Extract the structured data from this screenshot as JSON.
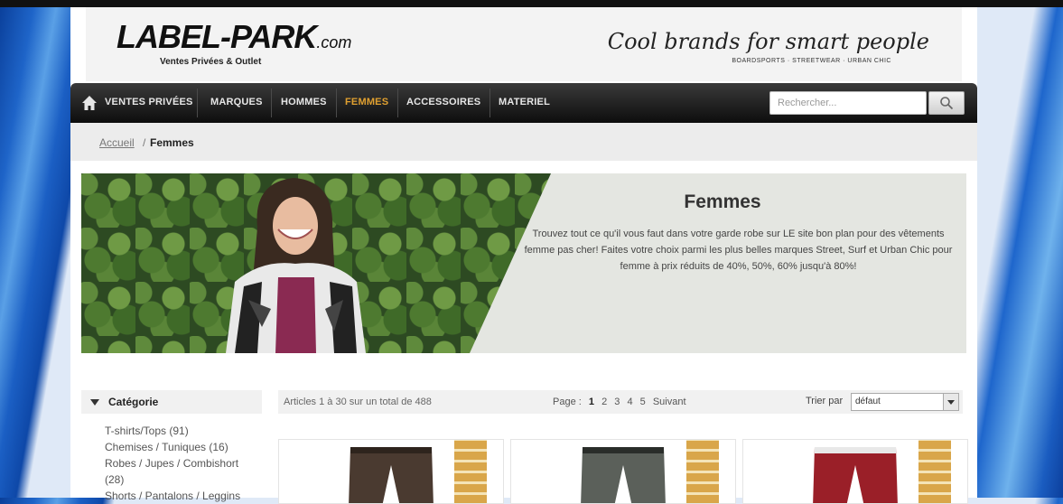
{
  "header": {
    "logo_main": "LABEL-PARK",
    "logo_suffix": ".com",
    "logo_tagline": "Ventes Privées & Outlet",
    "slogan": "Cool brands for smart people",
    "slogan_sub": "BOARDSPORTS · STREETWEAR · URBAN CHIC"
  },
  "nav": {
    "items": [
      "VENTES PRIVÉES",
      "MARQUES",
      "HOMMES",
      "FEMMES",
      "ACCESSOIRES",
      "MATERIEL"
    ],
    "active": "FEMMES",
    "search_placeholder": "Rechercher..."
  },
  "breadcrumb": {
    "home": "Accueil",
    "separator": "/",
    "current": "Femmes"
  },
  "banner": {
    "title": "Femmes",
    "text": "Trouvez tout ce qu'il vous faut dans votre garde robe sur LE site bon plan pour des vêtements femme pas cher! Faites votre choix parmi les plus belles marques Street, Surf et Urban Chic pour femme à prix réduits de 40%, 50%, 60% jusqu'à 80%!"
  },
  "sidebar": {
    "title": "Catégorie",
    "categories": [
      "T-shirts/Tops (91)",
      "Chemises / Tuniques (16)",
      "Robes / Jupes / Combishort",
      "(28)",
      "Shorts / Pantalons / Leggins"
    ]
  },
  "toolbar": {
    "count_text": "Articles 1 à 30 sur un total de 488",
    "page_label": "Page :",
    "pages": [
      "1",
      "2",
      "3",
      "4",
      "5"
    ],
    "current_page": "1",
    "next_label": "Suivant",
    "sort_label": "Trier par",
    "sort_value": "défaut"
  },
  "colors": {
    "nav_active": "#e0a030",
    "nav_bg": "#1a1a1a",
    "banner_panel": "#e4e6e1"
  }
}
